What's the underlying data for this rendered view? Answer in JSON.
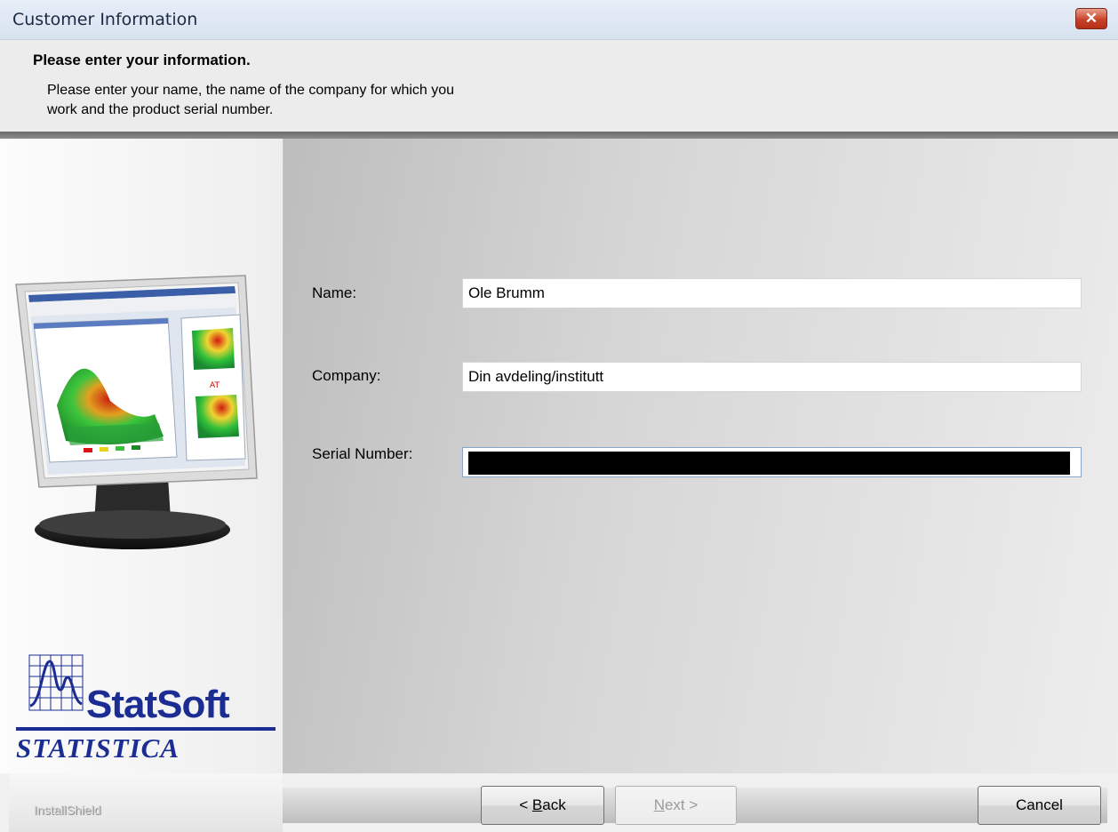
{
  "window": {
    "title": "Customer Information",
    "close_glyph": "✕"
  },
  "header": {
    "title": "Please enter your information.",
    "description_line1": "Please enter your name, the name of the company for which you",
    "description_line2": "work and the product serial number."
  },
  "form": {
    "name_label": "Name:",
    "name_value": "Ole Brumm",
    "company_label": "Company:",
    "company_value": "Din avdeling/institutt",
    "serial_label": "Serial Number:",
    "serial_value": ""
  },
  "branding": {
    "logo_statsoft": "StatSoft",
    "logo_statistica": "STATISTICA",
    "installer_brand": "InstallShield"
  },
  "buttons": {
    "back_prefix": "< ",
    "back_accel": "B",
    "back_rest": "ack",
    "next_accel": "N",
    "next_rest": "ext >",
    "cancel": "Cancel"
  },
  "icons": {
    "close": "close-icon",
    "monitor": "monitor-illustration",
    "logo": "statsoft-logo-icon"
  },
  "colors": {
    "brand_blue": "#1b2d93",
    "close_red": "#c8422a",
    "header_rule": "#707070"
  }
}
